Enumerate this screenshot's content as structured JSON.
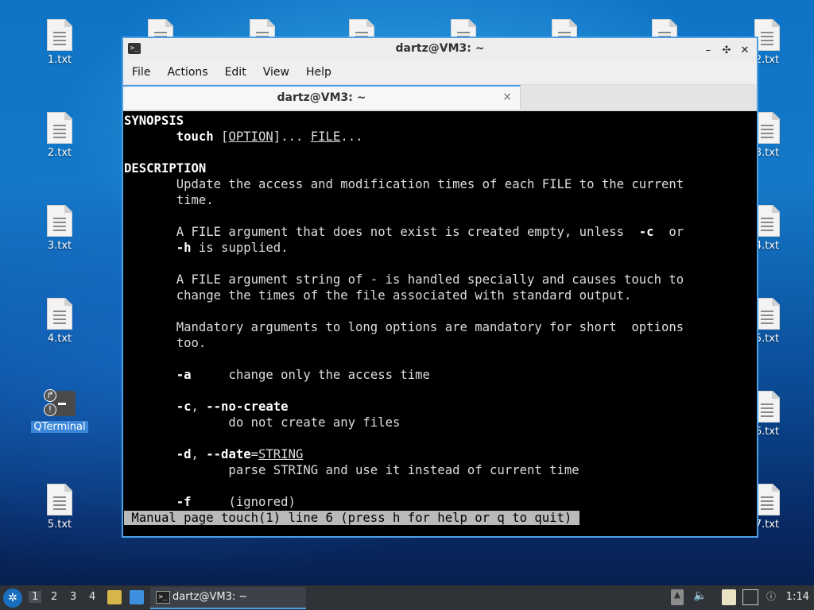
{
  "desktop": {
    "icons_left": [
      "1.txt",
      "2.txt",
      "3.txt",
      "4.txt",
      "5.txt"
    ],
    "icons_right": [
      "2.txt",
      "3.txt",
      "4.txt",
      "5.txt",
      "6.txt",
      "7.txt"
    ],
    "qterminal_label": "QTerminal"
  },
  "window": {
    "title": "dartz@VM3: ~",
    "controls": {
      "minimize": "–",
      "maximize": "✣",
      "close": "✕"
    },
    "menu": [
      "File",
      "Actions",
      "Edit",
      "View",
      "Help"
    ],
    "tab": {
      "title": "dartz@VM3: ~",
      "close": "×"
    }
  },
  "terminal": {
    "lines": [
      [
        {
          "t": "SYNOPSIS",
          "s": "b"
        }
      ],
      [
        {
          "t": "       "
        },
        {
          "t": "touch",
          "s": "b"
        },
        {
          "t": " ["
        },
        {
          "t": "OPTION",
          "s": "u"
        },
        {
          "t": "]... "
        },
        {
          "t": "FILE",
          "s": "u"
        },
        {
          "t": "..."
        }
      ],
      [],
      [
        {
          "t": "DESCRIPTION",
          "s": "b"
        }
      ],
      [
        {
          "t": "       Update the access and modification times of each FILE to the current"
        }
      ],
      [
        {
          "t": "       time."
        }
      ],
      [],
      [
        {
          "t": "       A FILE argument that does not exist is created empty, unless  "
        },
        {
          "t": "-c",
          "s": "b"
        },
        {
          "t": "  or"
        }
      ],
      [
        {
          "t": "       "
        },
        {
          "t": "-h",
          "s": "b"
        },
        {
          "t": " is supplied."
        }
      ],
      [],
      [
        {
          "t": "       A FILE argument string of - is handled specially and causes touch to"
        }
      ],
      [
        {
          "t": "       change the times of the file associated with standard output."
        }
      ],
      [],
      [
        {
          "t": "       Mandatory arguments to long options are mandatory for short  options"
        }
      ],
      [
        {
          "t": "       too."
        }
      ],
      [],
      [
        {
          "t": "       "
        },
        {
          "t": "-a",
          "s": "b"
        },
        {
          "t": "     change only the access time"
        }
      ],
      [],
      [
        {
          "t": "       "
        },
        {
          "t": "-c",
          "s": "b"
        },
        {
          "t": ", "
        },
        {
          "t": "--no-create",
          "s": "b"
        }
      ],
      [
        {
          "t": "              do not create any files"
        }
      ],
      [],
      [
        {
          "t": "       "
        },
        {
          "t": "-d",
          "s": "b"
        },
        {
          "t": ", "
        },
        {
          "t": "--date",
          "s": "b"
        },
        {
          "t": "="
        },
        {
          "t": "STRING",
          "s": "u"
        }
      ],
      [
        {
          "t": "              parse STRING and use it instead of current time"
        }
      ],
      [],
      [
        {
          "t": "       "
        },
        {
          "t": "-f",
          "s": "b"
        },
        {
          "t": "     (ignored)"
        }
      ],
      [
        {
          "t": " Manual page touch(1) line 6 (press h for help or q to quit) ",
          "s": "status"
        }
      ]
    ]
  },
  "taskbar": {
    "workspaces": [
      "1",
      "2",
      "3",
      "4"
    ],
    "active_workspace": "1",
    "task_title": "dartz@VM3: ~",
    "clock": "1:14"
  }
}
